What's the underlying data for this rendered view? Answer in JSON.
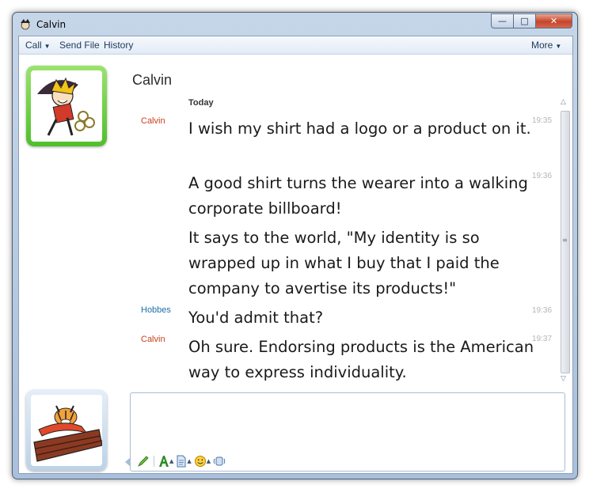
{
  "window": {
    "title": "Calvin",
    "icon": "calvin-app-icon",
    "caption_buttons": {
      "minimize": "—",
      "maximize": "□",
      "close": "✕"
    }
  },
  "toolbar": {
    "call_label": "Call",
    "send_file_label": "Send File",
    "history_label": "History",
    "more_label": "More",
    "caret": "▼"
  },
  "contact": {
    "name": "Calvin",
    "avatar": "calvin-umbrella-avatar",
    "presence_color": "#5cc52e"
  },
  "conversation": {
    "day_header": "Today",
    "messages": [
      {
        "sender": "Calvin",
        "time": "19:35",
        "text": "I wish my shirt had a logo or a product on it."
      },
      {
        "sender": "",
        "time": "19:36",
        "text": "A good shirt turns the wearer into a walking corporate billboard!"
      },
      {
        "sender": "",
        "time": "",
        "text": "It says to the world, \"My identity is so wrapped up in what I buy that I paid the company to avertise its products!\""
      },
      {
        "sender": "Hobbes",
        "time": "19:36",
        "text": "You'd admit that?"
      },
      {
        "sender": "Calvin",
        "time": "19:37",
        "text": "Oh sure. Endorsing products is the American way to express individuality."
      }
    ]
  },
  "self": {
    "avatar": "hobbes-wagon-avatar"
  },
  "input": {
    "value": "",
    "tools": [
      "handwriting-pen-icon",
      "font-icon",
      "document-icon",
      "emoticon-icon",
      "nudge-icon"
    ]
  },
  "colors": {
    "calvin_sender": "#c8401c",
    "hobbes_sender": "#1d6fa8"
  }
}
